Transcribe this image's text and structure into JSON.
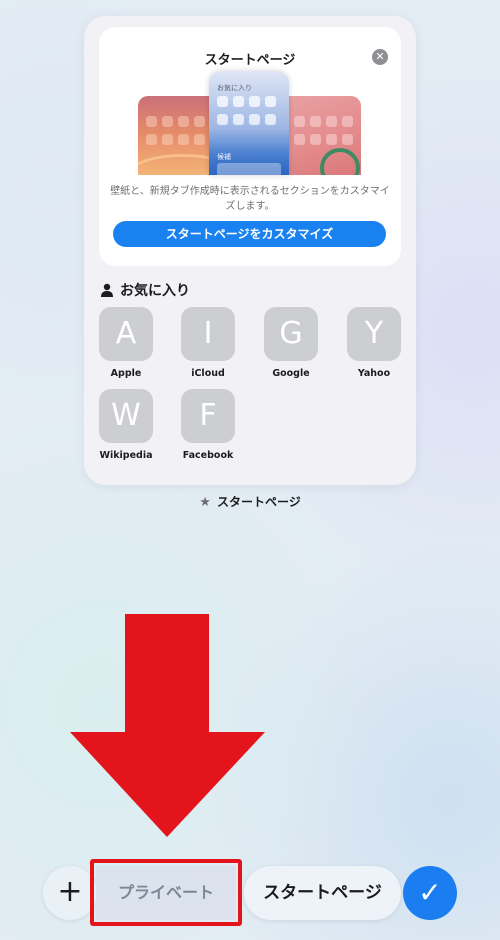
{
  "start_page_card": {
    "title": "スタートページ",
    "close_icon": "close-icon",
    "preview": {
      "favorites_label": "お気に入り",
      "suggestions_label": "候補"
    },
    "description": "壁紙と、新規タブ作成時に表示されるセクションをカスタマイズします。",
    "customize_button": "スタートページをカスタマイズ"
  },
  "favorites": {
    "header": "お気に入り",
    "icon": "person-icon",
    "items": [
      {
        "letter": "A",
        "name": "Apple"
      },
      {
        "letter": "I",
        "name": "iCloud"
      },
      {
        "letter": "G",
        "name": "Google"
      },
      {
        "letter": "Y",
        "name": "Yahoo"
      },
      {
        "letter": "W",
        "name": "Wikipedia"
      },
      {
        "letter": "F",
        "name": "Facebook"
      }
    ]
  },
  "tab_label": {
    "icon": "star-icon",
    "text": "スタートページ"
  },
  "toolbar": {
    "add_icon": "plus-icon",
    "private_label": "プライベート",
    "start_page_label": "スタートページ",
    "done_icon": "checkmark-icon"
  },
  "colors": {
    "accent": "#1a82f0",
    "annotation_red": "#e3141c",
    "tile_gray": "#cdced2"
  }
}
